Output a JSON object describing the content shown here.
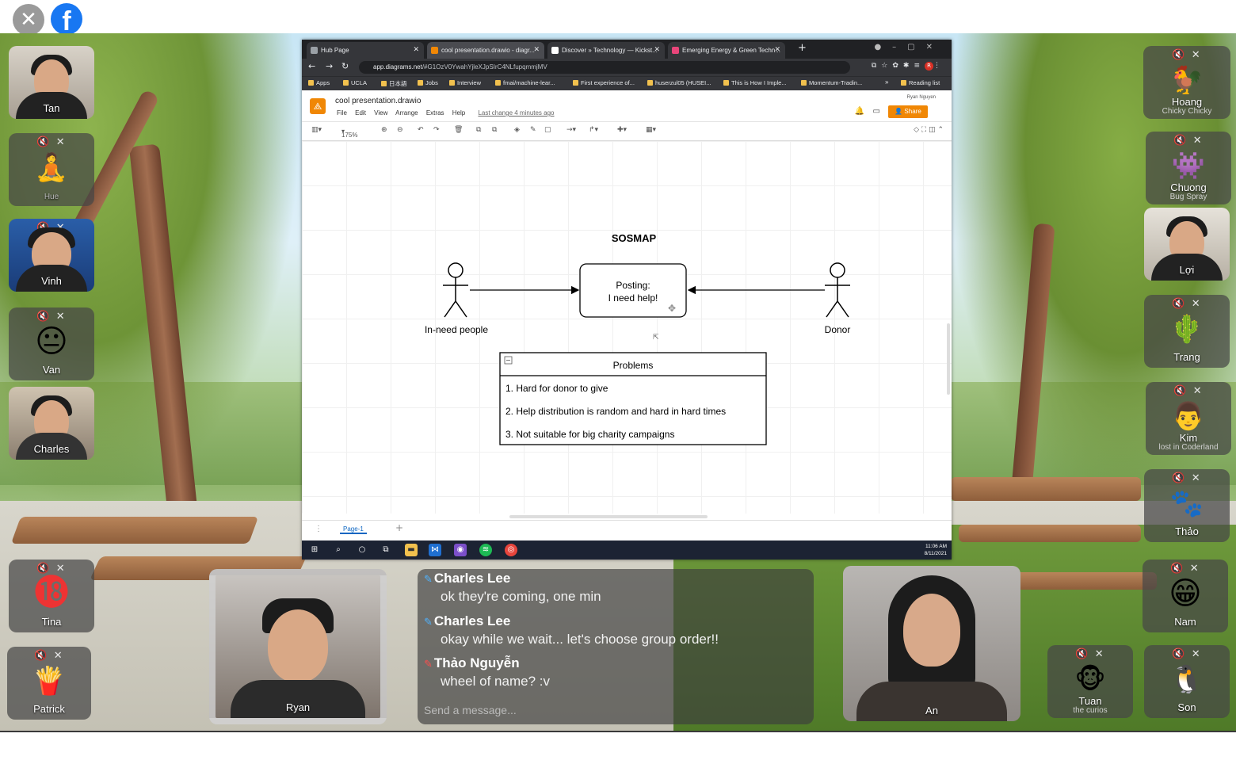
{
  "topbar": {
    "close_glyph": "✕",
    "logo_letter": "f"
  },
  "left_tiles": [
    {
      "name": "Tan",
      "sub": "",
      "status": "",
      "avatar": "",
      "type": "cam"
    },
    {
      "name": "Hue",
      "sub": "",
      "status": "🔇 ✕",
      "avatar": "🧘",
      "type": "avatar"
    },
    {
      "name": "Vinh",
      "sub": "",
      "status": "🔇 ✕",
      "avatar": "",
      "type": "cam"
    },
    {
      "name": "Van",
      "sub": "",
      "status": "🔇 ✕",
      "avatar": "😐",
      "type": "avatar"
    },
    {
      "name": "Charles",
      "sub": "",
      "status": "",
      "avatar": "",
      "type": "cam"
    },
    {
      "name": "Tina",
      "sub": "",
      "status": "🔇 ✕",
      "avatar": "⓲",
      "type": "avatar"
    },
    {
      "name": "Patrick",
      "sub": "",
      "status": "🔇 ✕",
      "avatar": "🍟",
      "type": "avatar"
    }
  ],
  "right_tiles": [
    {
      "name": "Hoang",
      "sub": "Chicky Chicky",
      "status": "🔇 ✕",
      "avatar": "🐓",
      "type": "avatar"
    },
    {
      "name": "Chuong",
      "sub": "Bug Spray",
      "status": "🔇 ✕",
      "avatar": "👾",
      "type": "avatar"
    },
    {
      "name": "Lợi",
      "sub": "",
      "status": "",
      "avatar": "",
      "type": "cam"
    },
    {
      "name": "Trang",
      "sub": "",
      "status": "🔇 ✕",
      "avatar": "🌵",
      "type": "avatar"
    },
    {
      "name": "Kim",
      "sub": "lost in Coderland",
      "status": "🔇 ✕",
      "avatar": "👨",
      "type": "avatar"
    },
    {
      "name": "Thảo",
      "sub": "",
      "status": "🔇 ✕",
      "avatar": "🐾",
      "type": "avatar"
    },
    {
      "name": "Nam",
      "sub": "",
      "status": "🔇 ✕",
      "avatar": "😁",
      "type": "avatar"
    },
    {
      "name": "Son",
      "sub": "",
      "status": "🔇 ✕",
      "avatar": "🐧",
      "type": "avatar"
    },
    {
      "name": "Tuan",
      "sub": "the curios",
      "status": "🔇 ✕",
      "avatar": "🐵",
      "type": "avatar"
    }
  ],
  "video_tiles": [
    {
      "name": "Ryan"
    },
    {
      "name": "An"
    }
  ],
  "browser": {
    "tabs": [
      "Hub Page",
      "cool presentation.drawio - diagr...",
      "Discover » Technology — Kickst...",
      "Emerging Energy & Green Techn..."
    ],
    "new_tab": "+",
    "url_host": "app.diagrams.net",
    "url_rest": "/#G1OzV0YwahYjleXJpSIrC4NLfupqmmjMV",
    "bookmarks": [
      "Apps",
      "UCLA",
      "日本語",
      "Jobs",
      "Interview",
      "fmai/machine-lear...",
      "First experience of...",
      "huserzul05 (HUSEI...",
      "This is How I Imple...",
      "Momentum-Tradin...",
      "»",
      "Reading list"
    ]
  },
  "drawio": {
    "doc_title": "cool presentation.drawio",
    "menu": [
      "File",
      "Edit",
      "View",
      "Arrange",
      "Extras",
      "Help"
    ],
    "last_change": "Last change 4 minutes ago",
    "user": "Ryan Nguyen",
    "share_label": "Share",
    "zoom": "175%",
    "page_tab": "Page-1"
  },
  "diagram": {
    "title": "SOSMAP",
    "actor_left": "In-need people",
    "actor_right": "Donor",
    "center_box_line1": "Posting:",
    "center_box_line2": "I need help!",
    "table_header": "Problems",
    "table_rows": [
      "1. Hard for donor to give",
      "2. Help distribution is random and hard in hard times",
      "3. Not suitable for big charity campaigns"
    ]
  },
  "taskbar": {
    "time": "11:06 AM",
    "date": "8/11/2021"
  },
  "chat": {
    "messages": [
      {
        "sender": "Charles Lee",
        "text": "ok they're coming, one min",
        "color": "#4fb3ff"
      },
      {
        "sender": "Charles Lee",
        "text": "okay while we wait... let's choose group order!!",
        "color": "#4fb3ff"
      },
      {
        "sender": "Thảo Nguyễn",
        "text": "wheel of name? :v",
        "color": "#ff4d4d"
      }
    ],
    "placeholder": "Send a message..."
  }
}
